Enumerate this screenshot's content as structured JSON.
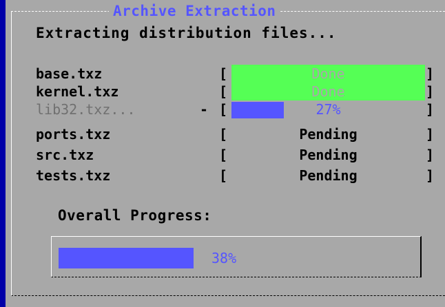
{
  "dialog": {
    "title": "Archive Extraction",
    "heading": "Extracting distribution files..."
  },
  "files": [
    {
      "name": "base.txz",
      "bracket_left": "[",
      "bracket_right": "]",
      "status": "Done",
      "state": "done",
      "progress": 1.0
    },
    {
      "name": "kernel.txz",
      "bracket_left": "[",
      "bracket_right": "]",
      "status": "Done",
      "state": "done",
      "progress": 1.0
    },
    {
      "name": "lib32.txz...",
      "marker": "-",
      "bracket_left": "[",
      "bracket_right": "]",
      "status": "27%",
      "state": "active",
      "progress": 0.27
    },
    {
      "name": "ports.txz",
      "bracket_left": "[",
      "bracket_right": "]",
      "status": "Pending",
      "state": "pending",
      "progress": 0
    },
    {
      "name": "src.txz",
      "bracket_left": "[",
      "bracket_right": "]",
      "status": "Pending",
      "state": "pending",
      "progress": 0
    },
    {
      "name": "tests.txz",
      "bracket_left": "[",
      "bracket_right": "]",
      "status": "Pending",
      "state": "pending",
      "progress": 0
    }
  ],
  "overall": {
    "label": "Overall Progress:",
    "percent_text": "38%",
    "progress": 0.38
  },
  "colors": {
    "background": "#0000a8",
    "dialog": "#a8a8a8",
    "done": "#55ff55",
    "progress": "#5555ff"
  }
}
